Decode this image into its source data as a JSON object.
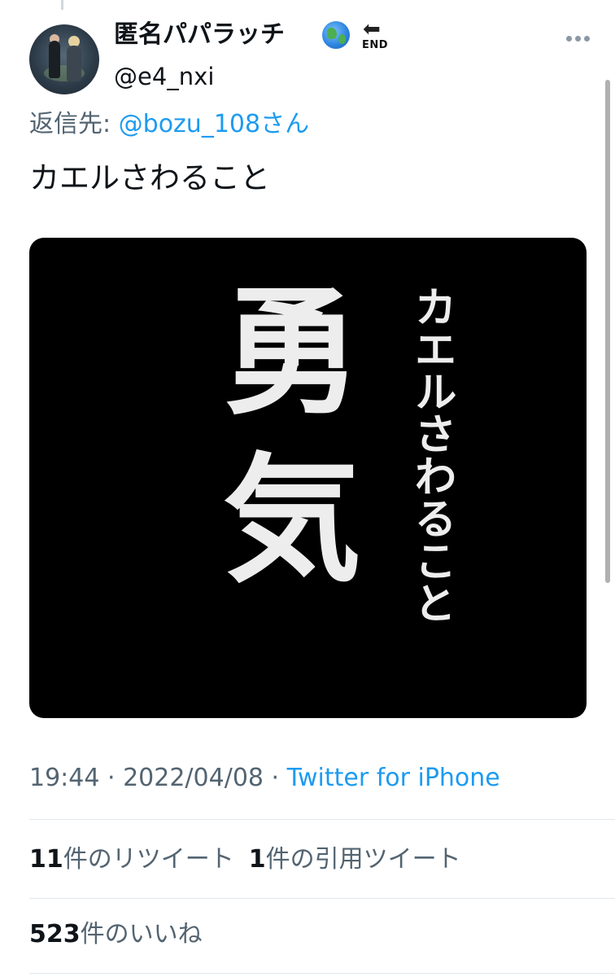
{
  "tweet": {
    "display_name": "匿名パパラッチ",
    "end_badge_label": "END",
    "handle": "@e4_nxi",
    "reply_label": "返信先: ",
    "reply_mention": "@bozu_108さん",
    "text": "カエルさわること"
  },
  "media": {
    "big_char_1": "勇",
    "big_char_2": "気",
    "vertical_text": "カエルさわること"
  },
  "meta": {
    "time": "19:44",
    "sep1": " · ",
    "date": "2022/04/08",
    "sep2": " · ",
    "source": "Twitter for iPhone"
  },
  "stats": {
    "retweets_count": "11",
    "retweets_label": "件のリツイート",
    "quotes_count": "1",
    "quotes_label": "件の引用ツイート",
    "likes_count": "523",
    "likes_label": "件のいいね"
  },
  "colors": {
    "link": "#1d9bf0",
    "secondary": "#536471",
    "text": "#0f1419",
    "media_bg": "#000000"
  },
  "icons": [
    "globe-icon",
    "end-arrow-icon",
    "more-icon"
  ]
}
